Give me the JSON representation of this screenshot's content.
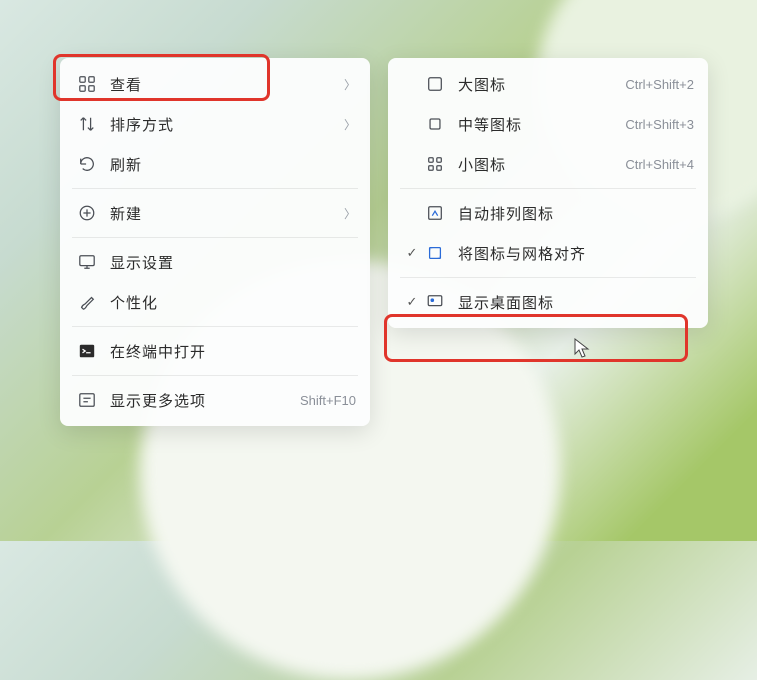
{
  "primaryMenu": {
    "view": {
      "label": "查看"
    },
    "sort": {
      "label": "排序方式"
    },
    "refresh": {
      "label": "刷新"
    },
    "new": {
      "label": "新建"
    },
    "display": {
      "label": "显示设置"
    },
    "personalize": {
      "label": "个性化"
    },
    "terminal": {
      "label": "在终端中打开"
    },
    "more": {
      "label": "显示更多选项",
      "accel": "Shift+F10"
    }
  },
  "submenu": {
    "large": {
      "label": "大图标",
      "accel": "Ctrl+Shift+2"
    },
    "medium": {
      "label": "中等图标",
      "accel": "Ctrl+Shift+3"
    },
    "small": {
      "label": "小图标",
      "accel": "Ctrl+Shift+4"
    },
    "auto": {
      "label": "自动排列图标"
    },
    "align": {
      "label": "将图标与网格对齐"
    },
    "show": {
      "label": "显示桌面图标"
    }
  }
}
